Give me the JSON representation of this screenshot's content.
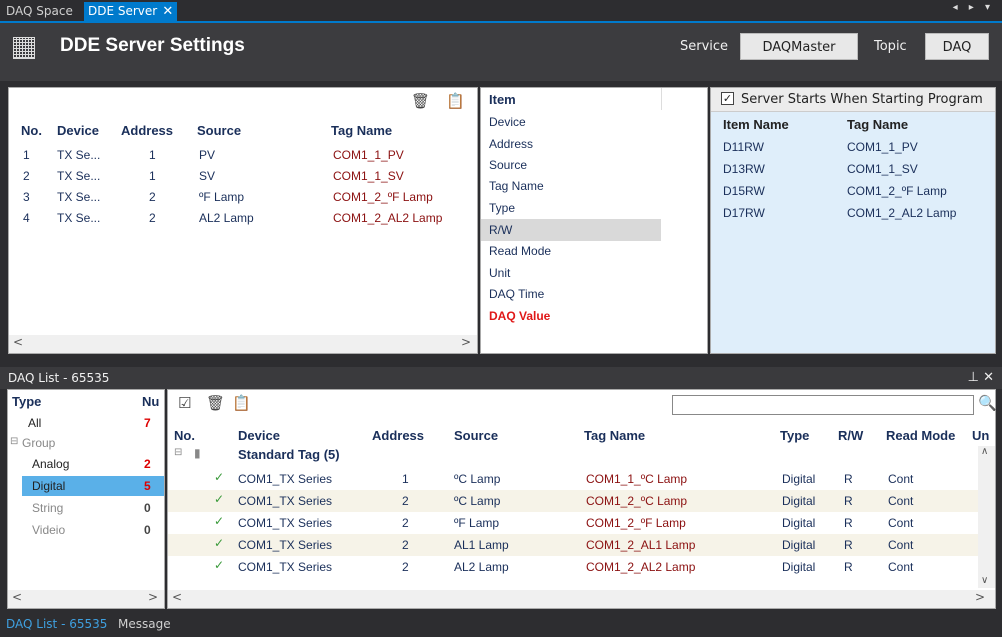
{
  "tabs": {
    "space": "DAQ Space",
    "dde": "DDE Server",
    "close": "✕",
    "controls": "◂ ▸ ▾"
  },
  "header": {
    "title": "DDE Server Settings",
    "service_label": "Service",
    "service_value": "DAQMaster",
    "topic_label": "Topic",
    "topic_value": "DAQ"
  },
  "settings_table": {
    "columns": [
      "No.",
      "Device",
      "Address",
      "Source",
      "Tag Name"
    ],
    "rows": [
      {
        "no": "1",
        "device": "TX Se...",
        "address": "1",
        "source": "PV",
        "tag": "COM1_1_PV"
      },
      {
        "no": "2",
        "device": "TX Se...",
        "address": "1",
        "source": "SV",
        "tag": "COM1_1_SV"
      },
      {
        "no": "3",
        "device": "TX Se...",
        "address": "2",
        "source": "ºF Lamp",
        "tag": "COM1_2_ºF Lamp"
      },
      {
        "no": "4",
        "device": "TX Se...",
        "address": "2",
        "source": "AL2 Lamp",
        "tag": "COM1_2_AL2 Lamp"
      }
    ]
  },
  "item_panel": {
    "header": "Item",
    "items": [
      "Device",
      "Address",
      "Source",
      "Tag Name",
      "Type",
      "R/W",
      "Read Mode",
      "Unit",
      "DAQ Time",
      "DAQ Value"
    ],
    "selected": "R/W"
  },
  "server_panel": {
    "checkbox_label": "Server Starts When Starting Program",
    "columns": [
      "Item Name",
      "Tag Name"
    ],
    "rows": [
      {
        "item": "D11RW",
        "tag": "COM1_1_PV"
      },
      {
        "item": "D13RW",
        "tag": "COM1_1_SV"
      },
      {
        "item": "D15RW",
        "tag": "COM1_2_ºF Lamp"
      },
      {
        "item": "D17RW",
        "tag": "COM1_2_AL2 Lamp"
      }
    ]
  },
  "daq_list": {
    "title": "DAQ List - 65535",
    "type_header": "Type",
    "num_header": "Nu",
    "types": [
      {
        "label": "All",
        "count": "7"
      },
      {
        "label": "Group",
        "count": ""
      },
      {
        "label": "Analog",
        "count": "2"
      },
      {
        "label": "Digital",
        "count": "5"
      },
      {
        "label": "String",
        "count": "0"
      },
      {
        "label": "Videio",
        "count": "0"
      }
    ],
    "columns": [
      "No.",
      "Device",
      "Address",
      "Source",
      "Tag Name",
      "Type",
      "R/W",
      "Read Mode",
      "Un"
    ],
    "group_label": "Standard Tag (5)",
    "rows": [
      {
        "device": "COM1_TX Series",
        "address": "1",
        "source": "ºC Lamp",
        "tag": "COM1_1_ºC Lamp",
        "type": "Digital",
        "rw": "R",
        "mode": "Cont"
      },
      {
        "device": "COM1_TX Series",
        "address": "2",
        "source": "ºC Lamp",
        "tag": "COM1_2_ºC Lamp",
        "type": "Digital",
        "rw": "R",
        "mode": "Cont"
      },
      {
        "device": "COM1_TX Series",
        "address": "2",
        "source": "ºF Lamp",
        "tag": "COM1_2_ºF Lamp",
        "type": "Digital",
        "rw": "R",
        "mode": "Cont"
      },
      {
        "device": "COM1_TX Series",
        "address": "2",
        "source": "AL1 Lamp",
        "tag": "COM1_2_AL1 Lamp",
        "type": "Digital",
        "rw": "R",
        "mode": "Cont"
      },
      {
        "device": "COM1_TX Series",
        "address": "2",
        "source": "AL2 Lamp",
        "tag": "COM1_2_AL2 Lamp",
        "type": "Digital",
        "rw": "R",
        "mode": "Cont"
      }
    ]
  },
  "status_bar": {
    "tab1": "DAQ List - 65535",
    "tab2": "Message"
  },
  "colors": {
    "accent": "#007acc",
    "selected_row": "#5ab0e8",
    "dark_red": "#8b1010",
    "navy": "#1a2f5a"
  }
}
